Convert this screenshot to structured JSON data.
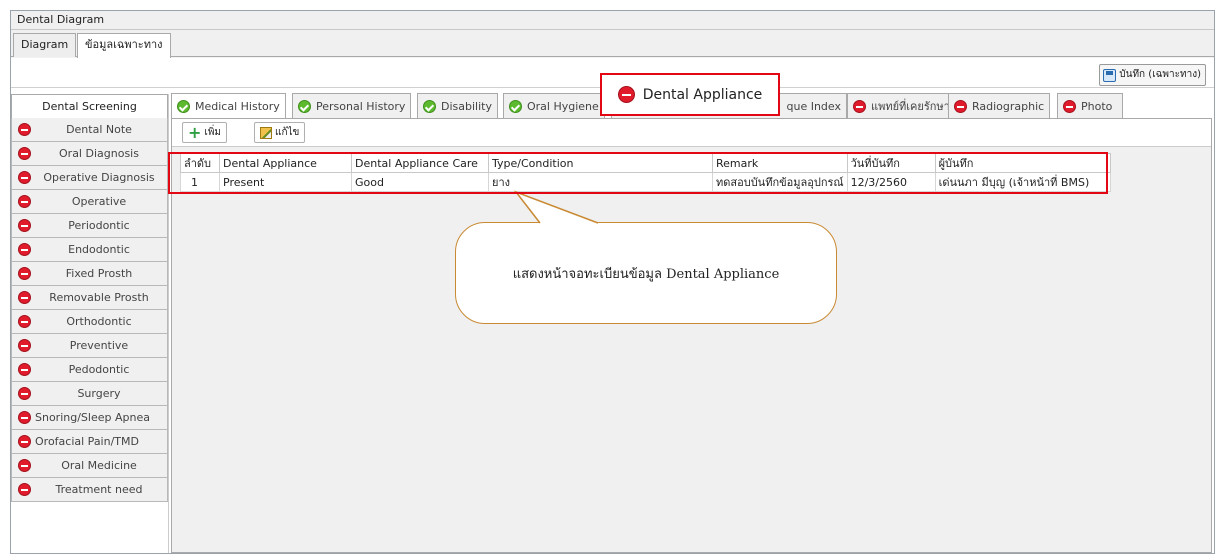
{
  "window": {
    "title": "Dental Diagram"
  },
  "outer_tabs": [
    {
      "label": "Diagram"
    },
    {
      "label": "ข้อมูลเฉพาะทาง"
    }
  ],
  "save_button": {
    "label": "บันทึก (เฉพาะทาง)"
  },
  "sidebar": {
    "header": "Dental Screening",
    "items": [
      {
        "label": "Dental Note"
      },
      {
        "label": "Oral Diagnosis"
      },
      {
        "label": "Operative Diagnosis"
      },
      {
        "label": "Operative"
      },
      {
        "label": "Periodontic"
      },
      {
        "label": "Endodontic"
      },
      {
        "label": "Fixed Prosth"
      },
      {
        "label": "Removable Prosth"
      },
      {
        "label": "Orthodontic"
      },
      {
        "label": "Preventive"
      },
      {
        "label": "Pedodontic"
      },
      {
        "label": "Surgery"
      },
      {
        "label": "Snoring/Sleep Apnea"
      },
      {
        "label": "Orofacial Pain/TMD"
      },
      {
        "label": "Oral Medicine"
      },
      {
        "label": "Treatment need"
      }
    ]
  },
  "inner_tabs": [
    {
      "label": "Medical History",
      "status": "green"
    },
    {
      "label": "Personal History",
      "status": "green"
    },
    {
      "label": "Disability",
      "status": "green"
    },
    {
      "label": "Oral Hygiene",
      "status": "green"
    },
    {
      "label": "que Index",
      "status": "none"
    },
    {
      "label": "แพทย์ที่เคยรักษา",
      "status": "red"
    },
    {
      "label": "Radiographic",
      "status": "red"
    },
    {
      "label": "Photo",
      "status": "red"
    }
  ],
  "highlight_tab": {
    "label": "Dental Appliance"
  },
  "toolbar": {
    "add_label": "เพิ่ม",
    "edit_label": "แก้ไข"
  },
  "table": {
    "columns": [
      "ลำดับ",
      "Dental Appliance",
      "Dental Appliance Care",
      "Type/Condition",
      "Remark",
      "วันที่บันทึก",
      "ผู้บันทึก"
    ],
    "rows": [
      [
        "1",
        "Present",
        "Good",
        "ยาง",
        "ทดสอบบันทึกข้อมูลอุปกรณ์",
        "12/3/2560",
        "เด่นนภา มีบุญ (เจ้าหน้าที่ BMS)"
      ]
    ]
  },
  "callout": {
    "text": "แสดงหน้าจอทะเบียนข้อมูล Dental Appliance"
  },
  "colors": {
    "highlight": "#e30613",
    "ok": "#5dba2f",
    "error": "#e01b2c",
    "callout_border": "#c98a34"
  }
}
